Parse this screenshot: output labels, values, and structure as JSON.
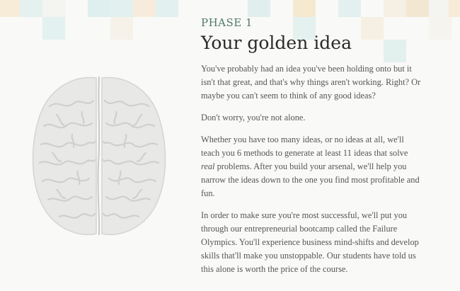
{
  "section": {
    "phase": "PHASE 1",
    "title": "Your golden idea"
  },
  "paragraphs": [
    "You've probably had an idea you've been holding onto but it isn't that great, and that's why things aren't working. Right? Or maybe you can't seem to think of any good ideas?",
    "Don't worry, you're not alone."
  ],
  "paragraph3": {
    "before": "Whether you have too many ideas, or no ideas at all, we'll teach you 6 methods to generate at least 11 ideas that solve ",
    "emphasis": "real",
    "after": " problems. After you build your arsenal, we'll help you narrow the ideas down to the one you find most profitable and fun."
  },
  "paragraph4": "In order to make sure you're most successful, we'll put you through our entrepreneurial bootcamp called the Failure Olympics. You'll experience business mind-shifts and develop skills that'll make you unstoppable. Our students have told us this alone is worth the price of the course.",
  "icons": {
    "illustration": "brain-illustration"
  },
  "colors": {
    "phase": "#4f7a6a",
    "title": "#2a2a2a",
    "body": "#555555",
    "background": "#f9f9f7"
  }
}
